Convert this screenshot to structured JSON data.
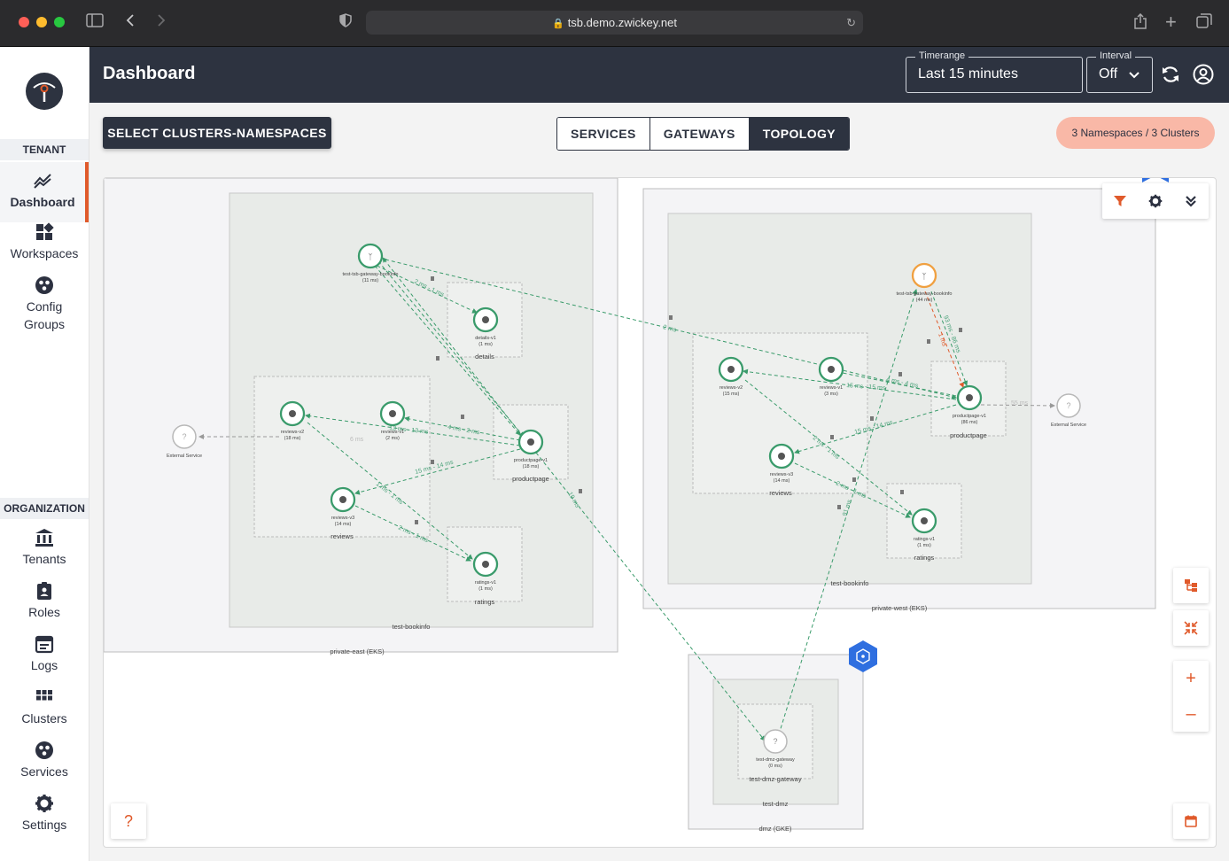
{
  "browser": {
    "url": "tsb.demo.zwickey.net"
  },
  "sidebar": {
    "tenant_section": "TENANT",
    "org_section": "ORGANIZATION",
    "tenant_items": [
      {
        "label": "Dashboard",
        "icon": "chart-line-icon",
        "active": true
      },
      {
        "label": "Workspaces",
        "icon": "workspaces-icon"
      },
      {
        "label": "Config Groups",
        "icon": "config-groups-icon"
      }
    ],
    "org_items": [
      {
        "label": "Tenants",
        "icon": "bank-icon"
      },
      {
        "label": "Roles",
        "icon": "badge-icon"
      },
      {
        "label": "Logs",
        "icon": "logs-icon"
      },
      {
        "label": "Clusters",
        "icon": "grid-icon"
      },
      {
        "label": "Services",
        "icon": "services-icon"
      },
      {
        "label": "Settings",
        "icon": "gear-icon"
      }
    ]
  },
  "header": {
    "title": "Dashboard",
    "timerange_label": "Timerange",
    "timerange_value": "Last 15 minutes",
    "interval_label": "Interval",
    "interval_value": "Off"
  },
  "toolbar": {
    "select_button": "SELECT CLUSTERS-NAMESPACES",
    "tabs": [
      "SERVICES",
      "GATEWAYS",
      "TOPOLOGY"
    ],
    "active_tab": "TOPOLOGY",
    "namespace_badge": "3 Namespaces / 3 Clusters"
  },
  "topology": {
    "clusters": [
      "private-east (EKS)",
      "private-west (EKS)",
      "dmz (GKE)"
    ],
    "namespaces": [
      "test-bookinfo",
      "test-bookinfo",
      "test-dmz"
    ],
    "groups": [
      "details",
      "productpage",
      "reviews",
      "ratings",
      "reviews",
      "productpage",
      "ratings",
      "test-dmz-gateway"
    ],
    "nodes": [
      {
        "name": "test-tsb-gateway-bookinfo",
        "latency": "(11 ms)"
      },
      {
        "name": "details-v1",
        "latency": "(1 ms)"
      },
      {
        "name": "reviews-v2",
        "latency": "(18 ms)"
      },
      {
        "name": "reviews-v1",
        "latency": "(2 ms)"
      },
      {
        "name": "productpage-v1",
        "latency": "(18 ms)"
      },
      {
        "name": "reviews-v3",
        "latency": "(14 ms)"
      },
      {
        "name": "ratings-v1",
        "latency": "(1 ms)"
      },
      {
        "name": "External Service",
        "latency": ""
      },
      {
        "name": "test-tsb-gateway-bookinfo",
        "latency": "(44 ms)"
      },
      {
        "name": "reviews-v2",
        "latency": "(15 ms)"
      },
      {
        "name": "reviews-v1",
        "latency": "(3 ms)"
      },
      {
        "name": "productpage-v1",
        "latency": "(86 ms)"
      },
      {
        "name": "reviews-v3",
        "latency": "(14 ms)"
      },
      {
        "name": "ratings-v1",
        "latency": "(1 ms)"
      },
      {
        "name": "External Service",
        "latency": ""
      },
      {
        "name": "test-dmz-gateway",
        "latency": "(0 ms)"
      }
    ],
    "edge_labels": [
      "2 ms - 1 ms",
      "4 ms - 2 ms",
      "13 ms - 13 ms",
      "15 ms - 14 ms",
      "1 ms - 1 ms",
      "2 ms - 1 ms",
      "6 ms",
      "2 ms",
      "15 ms - 15 ms",
      "4 ms - 4 ms",
      "15 ms - 14 ms",
      "2 ms - 1 ms",
      "2 ms - 1 ms",
      "55 ms",
      "93 ms - 86 ms",
      "1 ms",
      "91 ms",
      "19 ms"
    ]
  },
  "colors": {
    "accent": "#e05a2b",
    "header_bg": "#2d3340",
    "healthy": "#3a9b6b",
    "warning": "#f0a040",
    "error": "#e05a2b",
    "cluster_badge": "#2f6fe0"
  }
}
